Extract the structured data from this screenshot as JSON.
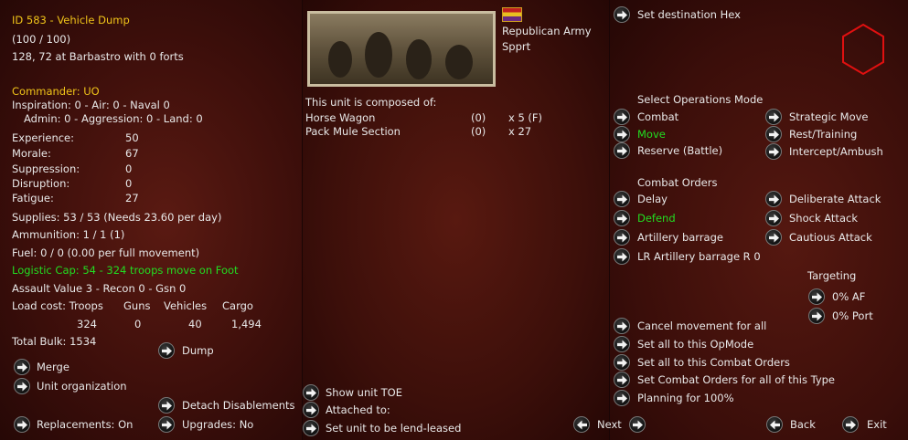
{
  "unit": {
    "title": "ID 583 - Vehicle Dump",
    "strength": "(100 / 100)",
    "location": "128, 72 at Barbastro with 0 forts",
    "commander": "Commander: UO",
    "inspiration": "Inspiration: 0 - Air: 0 - Naval 0",
    "admin": "Admin: 0 - Aggression: 0 - Land: 0",
    "stats": [
      {
        "label": "Experience:",
        "value": "50"
      },
      {
        "label": "Morale:",
        "value": "67"
      },
      {
        "label": "Suppression:",
        "value": "0"
      },
      {
        "label": "Disruption:",
        "value": "0"
      },
      {
        "label": "Fatigue:",
        "value": "27"
      }
    ],
    "supplies": "Supplies: 53 / 53 (Needs 23.60 per day)",
    "ammunition": "Ammunition: 1 / 1 (1)",
    "fuel": "Fuel: 0 / 0 (0.00 per full movement)",
    "logistic": "Logistic Cap: 54 - 324 troops move on Foot",
    "assault": "Assault Value 3 - Recon 0 - Gsn 0",
    "load_headers": [
      "Load cost: Troops",
      "Guns",
      "Vehicles",
      "Cargo"
    ],
    "load_values": [
      "324",
      "0",
      "40",
      "1,494"
    ],
    "bulk": "Total Bulk: 1534"
  },
  "left_buttons": {
    "dump": "Dump",
    "merge": "Merge",
    "organization": "Unit organization",
    "detach": "Detach Disablements",
    "replacements": "Replacements: On",
    "upgrades": "Upgrades: No"
  },
  "middle": {
    "army": "Republican Army",
    "type": "Spprt",
    "composed_title": "This unit is composed of:",
    "components": [
      {
        "name": "Horse Wagon",
        "qty": "(0)",
        "count": "x 5 (F)"
      },
      {
        "name": "Pack Mule Section",
        "qty": "(0)",
        "count": "x 27"
      }
    ],
    "show_toe": "Show unit TOE",
    "attached": "Attached to:",
    "lend_lease": "Set unit to be lend-leased"
  },
  "right": {
    "set_dest": "Set destination Hex",
    "ops_title": "Select Operations Mode",
    "ops_modes": [
      "Combat",
      "Move",
      "Reserve (Battle)",
      "Strategic Move",
      "Rest/Training",
      "Intercept/Ambush"
    ],
    "combat_title": "Combat Orders",
    "combat_orders": [
      "Delay",
      "Defend",
      "Artillery barrage",
      "LR Artillery barrage R 0",
      "Deliberate Attack",
      "Shock Attack",
      "Cautious Attack"
    ],
    "targeting_title": "Targeting",
    "targeting": [
      "0% AF",
      "0% Port"
    ],
    "bulk_actions": [
      "Cancel movement for all",
      "Set all to this OpMode",
      "Set all to this Combat Orders",
      "Set Combat Orders for all of this Type",
      "Planning for  100%"
    ],
    "next": "Next",
    "back": "Back",
    "exit": "Exit"
  },
  "colors": {
    "highlight": "#f0c419",
    "active": "#22dd22",
    "hex": "#e01010"
  }
}
